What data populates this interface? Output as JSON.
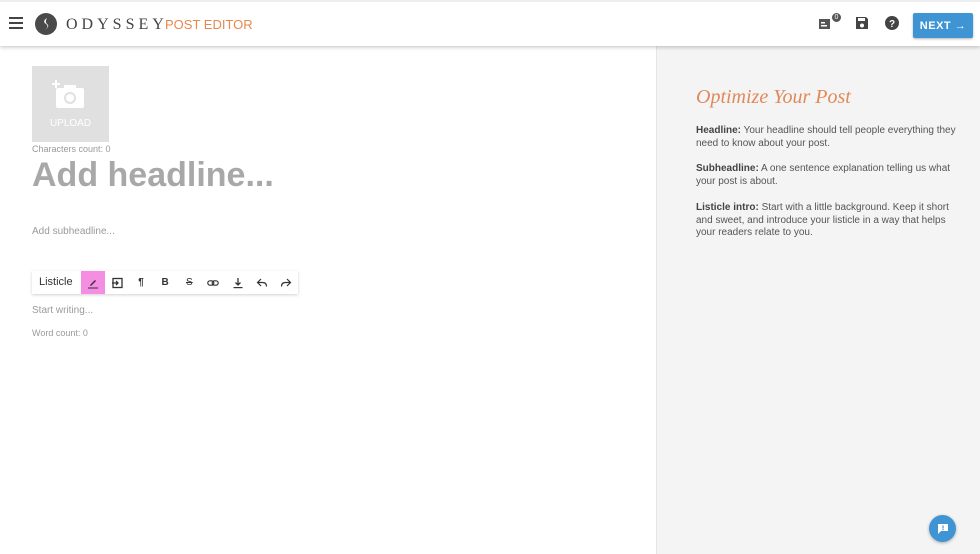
{
  "header": {
    "brand": "ODYSSEY",
    "section_title": "POST EDITOR",
    "notifications_count": "0",
    "next_label": "NEXT",
    "accent_color": "#e8874e",
    "button_color": "#3f95d3"
  },
  "editor": {
    "upload_label": "UPLOAD",
    "characters_count": "Characters count: 0",
    "headline_placeholder": "Add headline...",
    "subheadline_placeholder": "Add subheadline...",
    "toolbar": {
      "block_type": "Listicle",
      "buttons": [
        "highlight",
        "insert",
        "paragraph",
        "bold",
        "strikethrough",
        "link",
        "clear-format",
        "undo",
        "redo"
      ],
      "active_button": "highlight",
      "active_color": "#f58de3"
    },
    "body_placeholder": "Start writing...",
    "word_count": "Word count: 0"
  },
  "sidebar": {
    "title": "Optimize Your Post",
    "tips": [
      {
        "label": "Headline:",
        "text": " Your headline should tell people everything they need to know about your post."
      },
      {
        "label": "Subheadline:",
        "text": " A one sentence explanation telling us what your post is about."
      },
      {
        "label": "Listicle intro:",
        "text": " Start with a little background. Keep it short and sweet, and introduce your listicle in a way that helps your readers relate to you."
      }
    ]
  }
}
